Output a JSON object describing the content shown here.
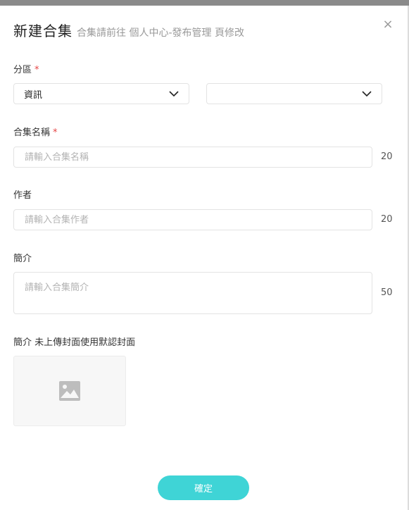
{
  "dialog": {
    "title": "新建合集",
    "subtitle": "合集請前往 個人中心-發布管理 頁修改",
    "close_icon": "×"
  },
  "fields": {
    "category": {
      "label": "分區",
      "required_mark": "*",
      "primary_value": "資訊",
      "secondary_value": ""
    },
    "name": {
      "label": "合集名稱",
      "required_mark": "*",
      "value": "",
      "placeholder": "請輸入合集名稱",
      "max_count": "20"
    },
    "author": {
      "label": "作者",
      "value": "",
      "placeholder": "請輸入合集作者",
      "max_count": "20"
    },
    "intro": {
      "label": "簡介",
      "value": "",
      "placeholder": "請輸入合集簡介",
      "max_count": "50"
    },
    "cover": {
      "label": "簡介 未上傳封面使用默認封面",
      "icon": "image-placeholder-icon"
    }
  },
  "actions": {
    "confirm_label": "確定"
  },
  "colors": {
    "accent": "#3fd4d6",
    "required": "#e64646",
    "border": "#e3e3e3",
    "muted": "#999999"
  }
}
